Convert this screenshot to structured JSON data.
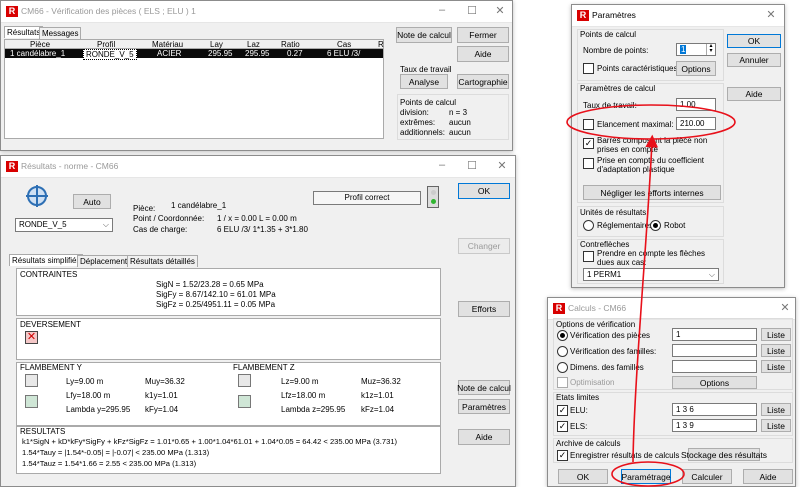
{
  "verif": {
    "title": "CM66 - Vérification des pièces ( ELS ; ELU ) 1",
    "tabs": [
      "Résultats",
      "Messages"
    ],
    "headers": [
      "Pièce",
      "Profil",
      "Matériau",
      "Lay",
      "Laz",
      "Ratio",
      "Cas",
      "R"
    ],
    "row": [
      "1 candélabre_1",
      "RONDE_V_5",
      "ACIER",
      "295.95",
      "295.95",
      "0.27",
      "6 ELU /3/"
    ],
    "btn_note": "Note de calcul",
    "btn_fermer": "Fermer",
    "btn_aide": "Aide",
    "taux_label": "Taux de travail",
    "btn_analyse": "Analyse",
    "btn_carto": "Cartographie",
    "points_title": "Points de calcul",
    "pts": [
      [
        "division:",
        "n = 3"
      ],
      [
        "extrêmes:",
        "aucun"
      ],
      [
        "additionnels:",
        "aucun"
      ]
    ]
  },
  "res": {
    "title": "Résultats - norme - CM66",
    "btn_auto": "Auto",
    "profile": "RONDE_V_5",
    "piece_l": "Pièce:",
    "piece_v": "1  candélabre_1",
    "point_l": "Point / Coordonnée:",
    "point_v": "1 / x = 0.00 L = 0.00 m",
    "cas_l": "Cas de charge:",
    "cas_v": "6 ELU /3/  1*1.35 + 3*1.80",
    "status": "Profil correct",
    "btn_ok": "OK",
    "btn_changer": "Changer",
    "btn_efforts": "Efforts",
    "btn_note": "Note de calcul",
    "btn_params": "Paramètres",
    "btn_aide": "Aide",
    "tabs": [
      "Résultats simplifiés",
      "Déplacements",
      "Résultats détaillés"
    ],
    "contraintes_t": "CONTRAINTES",
    "c1": "SigN = 1.52/23.28 = 0.65 MPa",
    "c2": "SigFy = 8.67/142.10 = 61.01 MPa",
    "c3": "SigFz = 0.25/4951.11 = 0.05 MPa",
    "dev_t": "DEVERSEMENT",
    "fy_t": "FLAMBEMENT Y",
    "fy": [
      "Ly=9.00 m",
      "Muy=36.32",
      "Lfy=18.00 m",
      "k1y=1.01",
      "Lambda y=295.95",
      "kFy=1.04"
    ],
    "fz_t": "FLAMBEMENT Z",
    "fz": [
      "Lz=9.00 m",
      "Muz=36.32",
      "Lfz=18.00 m",
      "k1z=1.01",
      "Lambda z=295.95",
      "kFz=1.04"
    ],
    "resultats_t": "RESULTATS",
    "r1": "k1*SigN + kD*kFy*SigFy + kFz*SigFz = 1.01*0.65 + 1.00*1.04*61.01 + 1.04*0.05 =   64.42   < 235.00 MPa  (3.731)",
    "r2": "1.54*Tauy = |1.54*-0.05| = |-0.07| < 235.00 MPa   (1.313)",
    "r3": "1.54*Tauz = 1.54*1.66 = 2.55 < 235.00 MPa   (1.313)"
  },
  "param": {
    "title": "Paramètres",
    "pc_t": "Points de calcul",
    "nb_l": "Nombre de points:",
    "nb_v": "1",
    "pcar": "Points caractéristiques",
    "btn_opt": "Options",
    "btn_ok": "OK",
    "btn_annuler": "Annuler",
    "btn_aide": "Aide",
    "prc_t": "Paramètres de calcul",
    "taux_l": "Taux de travail:",
    "taux_v": "1.00",
    "elan_l": "Elancement maximal:",
    "elan_v": "210.00",
    "barres": "Barres composant la pièce non prises en compte",
    "plast": "Prise en compte du coefficient d'adaptation plastique",
    "btn_neg": "Négliger les efforts internes",
    "unit_t": "Unités de résultats",
    "u1": "Réglementaires",
    "u2": "Robot",
    "contr_t": "Contreflèches",
    "contr_chk": "Prendre en compte les flèches dues aux cas:",
    "contr_sel": "1  PERM1"
  },
  "calc": {
    "title": "Calculs - CM66",
    "opt_t": "Options de vérification",
    "o1": "Vérification des pièces",
    "o1v": "1",
    "o2": "Vérification des familles:",
    "o3": "Dimens. des familles",
    "optim": "Optimisation",
    "btn_liste": "Liste",
    "btn_options": "Options",
    "etats_t": "Etats limites",
    "elu": "ELU:",
    "elu_v": "1 3 6",
    "els": "ELS:",
    "els_v": "1 3 9",
    "arch_t": "Archive de calculs",
    "arch_chk": "Enregistrer résultats de calculs",
    "btn_stock": "Stockage des résultats",
    "btn_ok": "OK",
    "btn_param": "Paramétrage",
    "btn_calc": "Calculer",
    "btn_aide": "Aide"
  },
  "colors": {
    "annot": "#e8101a",
    "sel_row": "#0a0a0a",
    "accent": "#0078d7"
  }
}
